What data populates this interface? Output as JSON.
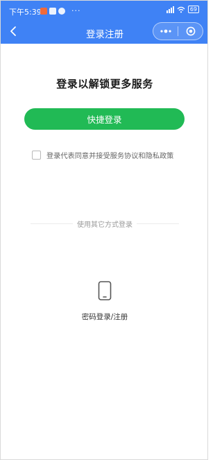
{
  "status_bar": {
    "time": "下午5:39",
    "more": "···",
    "battery": "69"
  },
  "navbar": {
    "title": "登录注册",
    "back_icon": "chevron-left-icon",
    "menu_icon": "more-dots-icon",
    "close_icon": "target-circle-icon"
  },
  "main": {
    "headline": "登录以解锁更多服务",
    "quick_login_label": "快捷登录",
    "agreement_text": "登录代表同意并接受服务协议和隐私政策",
    "divider_text": "使用其它方式登录",
    "password_login_label": "密码登录/注册",
    "password_login_icon": "phone-icon"
  },
  "colors": {
    "primary_blue": "#3f82f5",
    "button_green": "#21ba55"
  }
}
